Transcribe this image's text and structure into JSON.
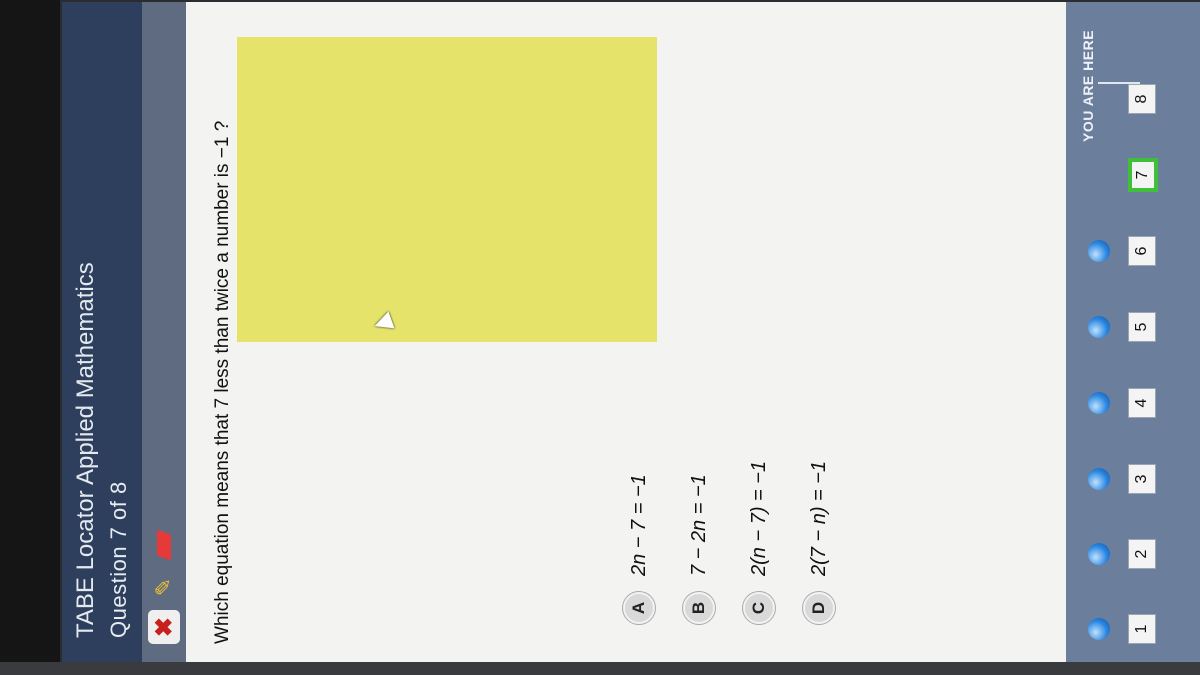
{
  "header": {
    "app_title": "TABE Locator Applied Mathematics",
    "question_counter": "Question 7 of 8"
  },
  "toolbar": {
    "close_icon": "✖",
    "highlighter_icon": "✎"
  },
  "question": {
    "text": "Which equation means that 7 less than twice a number is −1 ?"
  },
  "answers": [
    {
      "letter": "A",
      "text": "2n − 7 = −1"
    },
    {
      "letter": "B",
      "text": "7 − 2n = −1"
    },
    {
      "letter": "C",
      "text": "2(n − 7) = −1"
    },
    {
      "letter": "D",
      "text": "2(7 − n) = −1"
    }
  ],
  "navigation": {
    "you_are_here": "YOU ARE HERE",
    "current": "7",
    "items": [
      "1",
      "2",
      "3",
      "4",
      "5",
      "6",
      "7",
      "8"
    ]
  },
  "colors": {
    "header": "#2d3f5c",
    "highlight": "#e5e36a",
    "nav_bar": "#6b7f9c",
    "current_item_border": "#3fbf3a"
  }
}
